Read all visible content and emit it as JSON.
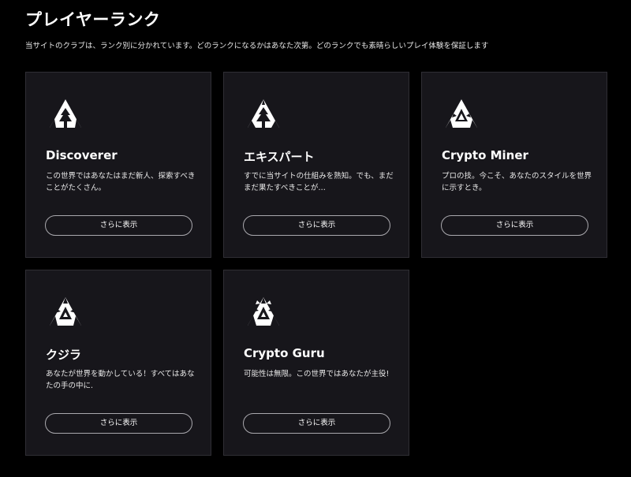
{
  "header": {
    "title": "プレイヤーランク",
    "subtitle": "当サイトのクラブは、ランク別に分かれています。どのランクになるかはあなた次第。どのランクでも素晴らしいプレイ体験を保証します"
  },
  "cards": [
    {
      "title": "Discoverer",
      "description": "この世界ではあなたはまだ新人、探索すべきことがたくさん。",
      "button": "さらに表示",
      "icon": "rank-1-icon"
    },
    {
      "title": "エキスパート",
      "description": "すでに当サイトの仕組みを熟知。でも、まだまだ果たすべきことが…",
      "button": "さらに表示",
      "icon": "rank-2-icon"
    },
    {
      "title": "Crypto Miner",
      "description": "プロの技。今こそ、あなたのスタイルを世界に示すとき。",
      "button": "さらに表示",
      "icon": "rank-3-icon"
    },
    {
      "title": "クジラ",
      "description": "あなたが世界を動かしている！すべてはあなたの手の中に.",
      "button": "さらに表示",
      "icon": "rank-4-icon"
    },
    {
      "title": "Crypto Guru",
      "description": "可能性は無限。この世界ではあなたが主役!",
      "button": "さらに表示",
      "icon": "rank-5-icon"
    }
  ],
  "colors": {
    "background": "#000000",
    "card_background": "#17161b",
    "card_border": "#2f2e34",
    "button_border": "#a9a8ad",
    "text": "#ffffff"
  }
}
